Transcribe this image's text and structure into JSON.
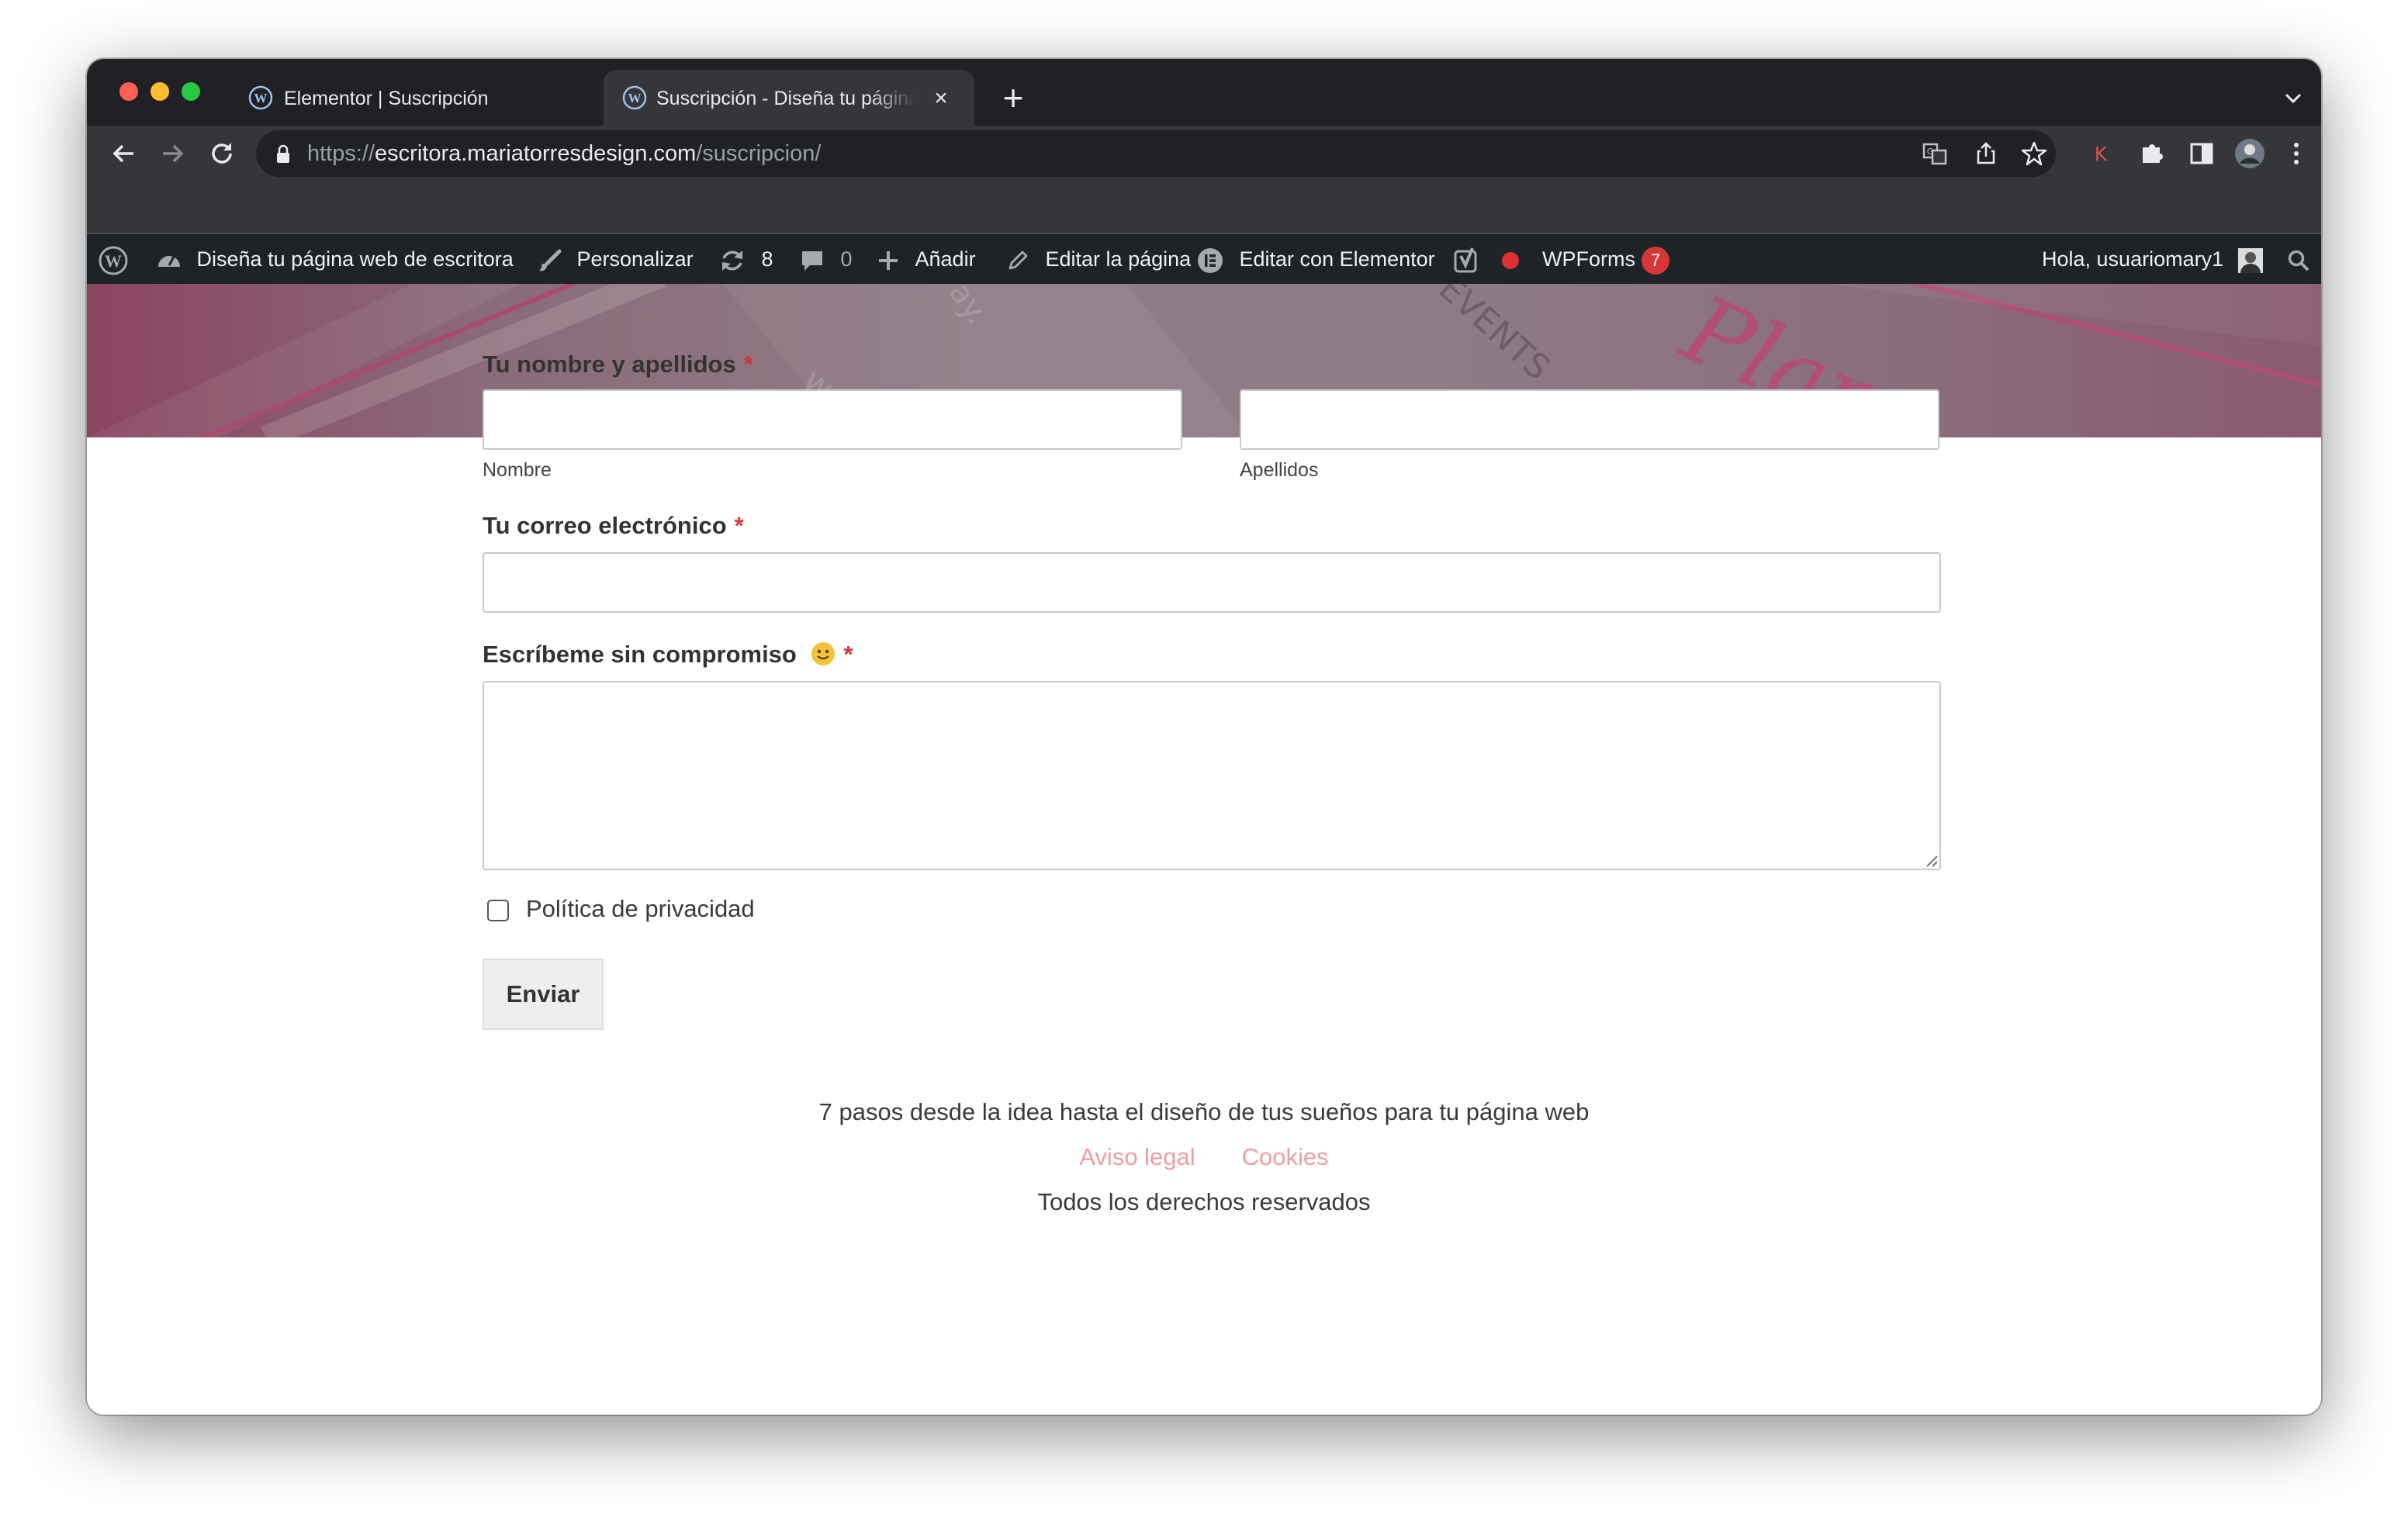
{
  "browser": {
    "tabs": [
      {
        "title": "Elementor | Suscripción",
        "active": false
      },
      {
        "title": "Suscripción - Diseña tu página web de escritora",
        "active": true
      }
    ],
    "new_tab": "+",
    "close_glyph": "×",
    "url": {
      "scheme": "https://",
      "host": "escritora.mariatorresdesign.com",
      "path": "/suscripcion/"
    },
    "extension_k": "K"
  },
  "adminbar": {
    "site_name": "Diseña tu página web de escritora",
    "customize": "Personalizar",
    "updates_count": "8",
    "comments_count": "0",
    "add_new": "Añadir",
    "edit_page": "Editar la página",
    "edit_elementor": "Editar con Elementor",
    "wpforms": "WPForms",
    "wpforms_count": "7",
    "greeting": "Hola, usuariomary1"
  },
  "form": {
    "name_label": "Tu nombre y apellidos",
    "required_mark": "*",
    "first_sublabel": "Nombre",
    "last_sublabel": "Apellidos",
    "email_label": "Tu correo electrónico",
    "message_label": "Escríbeme sin compromiso",
    "privacy_label": "Política de privacidad",
    "privacy_checked": false,
    "submit_label": "Enviar"
  },
  "footer": {
    "tagline": "7 pasos desde la idea hasta el diseño de tus sueños para tu página web",
    "links": [
      "Aviso legal",
      "Cookies"
    ],
    "rights": "Todos los derechos reservados"
  },
  "colors": {
    "required": "#d63637",
    "footer_link": "#eb9ea4",
    "admin_badge": "#d63638"
  }
}
